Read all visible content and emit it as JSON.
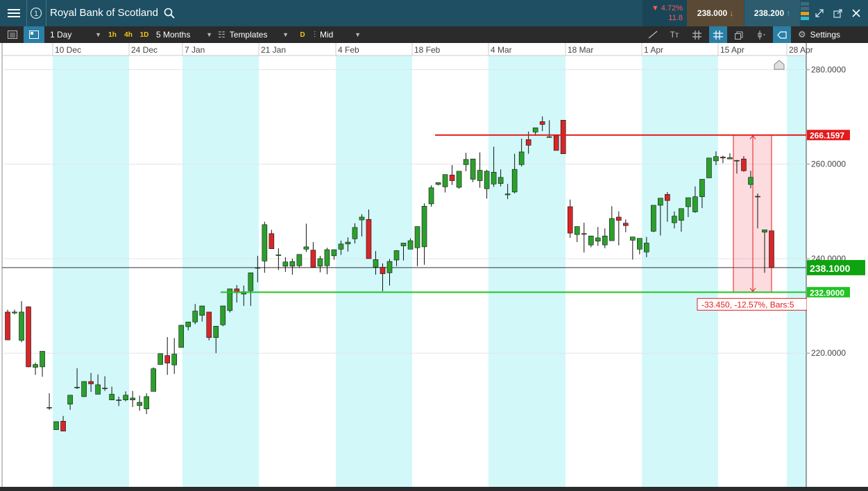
{
  "header": {
    "title": "Royal Bank of Scotland",
    "change_pct": "▼ 4.72%",
    "change_abs": "11.8",
    "sell_price": "238.000",
    "buy_price": "238.200"
  },
  "toolbar": {
    "interval": "1 Day",
    "quick_intervals": [
      "1h",
      "4h",
      "1D"
    ],
    "range": "5 Months",
    "templates": "Templates",
    "d_badge": "D",
    "price_mode": "Mid",
    "settings": "Settings"
  },
  "colors": {
    "header_bg": "#1e4f63",
    "toolbar_bg": "#2b2b2b",
    "up": "#2ca02c",
    "down": "#d62728",
    "weekend_band": "#d2f8fa",
    "resistance": "#e31a1c",
    "support": "#22c322",
    "current_price": "#0fa30f"
  },
  "chart_data": {
    "type": "candlestick",
    "x_tick_labels": [
      "10 Dec",
      "24 Dec",
      "7 Jan",
      "21 Jan",
      "4 Feb",
      "18 Feb",
      "4 Mar",
      "18 Mar",
      "1 Apr",
      "15 Apr",
      "28 Apr"
    ],
    "y_tick_labels": [
      "280.0000",
      "260.0000",
      "240.0000",
      "220.0000"
    ],
    "ylim": [
      191.7,
      283
    ],
    "candles": [
      [
        228.7,
        229.2,
        222.8,
        222.8
      ],
      [
        228.5,
        229.2,
        228.2,
        228.7
      ],
      [
        222.7,
        231.0,
        222.3,
        228.7
      ],
      [
        229.8,
        229.9,
        217.0,
        217.1
      ],
      [
        217.0,
        218.0,
        215.4,
        217.6
      ],
      [
        217.1,
        220.0,
        215.0,
        220.4
      ],
      [
        208.5,
        211.5,
        208.0,
        208.5
      ],
      [
        203.8,
        205.1,
        203.8,
        205.5
      ],
      [
        205.6,
        206.7,
        204.3,
        203.5
      ],
      [
        209.2,
        211.1,
        208.0,
        211.1
      ],
      [
        212.8,
        216.8,
        212.4,
        212.8
      ],
      [
        210.8,
        214.0,
        210.7,
        214.0
      ],
      [
        214.0,
        215.8,
        211.8,
        213.5
      ],
      [
        211.3,
        215.5,
        211.3,
        213.3
      ],
      [
        212.6,
        215.1,
        212.0,
        212.6
      ],
      [
        210.1,
        212.9,
        210.1,
        211.3
      ],
      [
        210.1,
        210.8,
        208.8,
        210.1
      ],
      [
        210.1,
        211.9,
        209.8,
        211.1
      ],
      [
        210.1,
        212.0,
        208.6,
        210.5
      ],
      [
        208.9,
        211.0,
        207.8,
        209.6
      ],
      [
        208.2,
        211.5,
        207.1,
        210.8
      ],
      [
        211.9,
        217.0,
        211.9,
        216.7
      ],
      [
        217.6,
        219.6,
        217.6,
        219.9
      ],
      [
        219.5,
        223.4,
        215.4,
        217.9
      ],
      [
        217.5,
        223.2,
        215.6,
        219.8
      ],
      [
        221.2,
        226.0,
        221.2,
        225.9
      ],
      [
        225.6,
        226.5,
        224.8,
        226.6
      ],
      [
        226.6,
        230.4,
        226.1,
        228.9
      ],
      [
        228.0,
        229.8,
        226.7,
        230.0
      ],
      [
        228.7,
        228.7,
        222.7,
        223.3
      ],
      [
        223.3,
        223.3,
        220.0,
        225.7
      ],
      [
        226.0,
        229.2,
        225.7,
        230.0
      ],
      [
        229.0,
        229.0,
        228.6,
        233.6
      ],
      [
        233.6,
        234.4,
        230.7,
        232.8
      ],
      [
        232.5,
        234.3,
        230.0,
        233.0
      ],
      [
        233.2,
        234.5,
        230.0,
        237.0
      ],
      [
        238.1,
        240.6,
        235.0,
        238.1
      ],
      [
        239.5,
        247.8,
        237.0,
        247.2
      ],
      [
        245.3,
        246.1,
        242.6,
        242.1
      ],
      [
        240.8,
        242.2,
        237.6,
        240.8
      ],
      [
        238.4,
        240.3,
        237.2,
        239.3
      ],
      [
        238.4,
        240.0,
        236.6,
        239.4
      ],
      [
        238.5,
        240.2,
        238.1,
        240.9
      ],
      [
        242.0,
        247.4,
        241.4,
        242.5
      ],
      [
        241.8,
        243.5,
        239.5,
        238.2
      ],
      [
        238.4,
        240.6,
        237.1,
        240.0
      ],
      [
        238.5,
        242.3,
        236.7,
        241.9
      ],
      [
        240.6,
        240.6,
        239.8,
        241.9
      ],
      [
        242.0,
        243.8,
        240.8,
        243.1
      ],
      [
        243.1,
        244.5,
        241.5,
        243.5
      ],
      [
        244.2,
        247.5,
        243.2,
        246.6
      ],
      [
        248.2,
        249.4,
        244.7,
        248.8
      ],
      [
        248.3,
        250.4,
        240.0,
        240.0
      ],
      [
        238.2,
        241.6,
        236.6,
        239.8
      ],
      [
        238.2,
        239.0,
        233.1,
        236.8
      ],
      [
        237.0,
        239.9,
        234.3,
        239.4
      ],
      [
        239.7,
        241.8,
        238.4,
        241.7
      ],
      [
        242.7,
        243.3,
        239.6,
        243.3
      ],
      [
        242.0,
        244.3,
        243.3,
        243.8
      ],
      [
        242.3,
        242.9,
        238.4,
        246.8
      ],
      [
        242.5,
        251.7,
        238.7,
        251.1
      ],
      [
        251.6,
        255.5,
        251.0,
        255.0
      ],
      [
        255.7,
        256.0,
        255.5,
        256.1
      ],
      [
        255.2,
        257.4,
        254.0,
        257.8
      ],
      [
        257.7,
        259.8,
        255.6,
        256.5
      ],
      [
        255.1,
        257.3,
        254.8,
        258.5
      ],
      [
        259.9,
        262.4,
        258.5,
        261.0
      ],
      [
        256.8,
        260.6,
        256.2,
        261.1
      ],
      [
        256.5,
        262.5,
        255.0,
        258.7
      ],
      [
        254.8,
        258.8,
        252.7,
        258.5
      ],
      [
        255.8,
        263.7,
        255.2,
        258.3
      ],
      [
        255.9,
        258.9,
        255.3,
        257.2
      ],
      [
        253.5,
        255.8,
        252.6,
        253.7
      ],
      [
        254.1,
        262.2,
        253.8,
        258.9
      ],
      [
        259.9,
        265.4,
        259.5,
        262.6
      ],
      [
        265.2,
        266.9,
        262.2,
        264.0
      ],
      [
        266.8,
        266.0,
        266.1,
        267.7
      ],
      [
        269.0,
        270.1,
        267.0,
        268.4
      ],
      [
        265.8,
        269.3,
        265.8,
        265.8
      ],
      [
        266.0,
        264.3,
        262.9,
        262.9
      ],
      [
        269.3,
        265.7,
        262.6,
        262.2
      ],
      [
        251.0,
        252.5,
        244.4,
        245.4
      ],
      [
        245.1,
        246.8,
        243.5,
        246.8
      ],
      [
        245.3,
        247.6,
        241.3,
        245.2
      ],
      [
        242.9,
        244.7,
        242.4,
        244.8
      ],
      [
        243.7,
        246.7,
        242.7,
        244.4
      ],
      [
        242.9,
        246.4,
        242.2,
        244.8
      ],
      [
        243.8,
        251.1,
        247.8,
        248.5
      ],
      [
        248.8,
        250.0,
        242.8,
        248.1
      ],
      [
        247.5,
        248.3,
        245.6,
        247.0
      ],
      [
        243.9,
        243.9,
        239.8,
        244.6
      ],
      [
        242.0,
        243.7,
        240.9,
        244.3
      ],
      [
        241.4,
        244.6,
        240.3,
        243.3
      ],
      [
        245.8,
        247.9,
        245.6,
        251.3
      ],
      [
        251.3,
        252.2,
        244.9,
        252.8
      ],
      [
        253.6,
        254.1,
        247.8,
        252.3
      ],
      [
        247.6,
        250.0,
        246.4,
        249.0
      ],
      [
        248.1,
        249.4,
        245.7,
        250.6
      ],
      [
        251.0,
        251.3,
        248.8,
        252.9
      ],
      [
        249.9,
        255.3,
        249.7,
        253.1
      ],
      [
        253.1,
        256.8,
        250.7,
        256.8
      ],
      [
        257.1,
        260.2,
        257.1,
        261.3
      ],
      [
        260.7,
        262.7,
        259.8,
        261.6
      ],
      [
        261.5,
        261.8,
        260.2,
        261.3
      ],
      [
        261.1,
        262.3,
        261.2,
        261.4
      ],
      [
        260.7,
        260.9,
        258.0,
        260.8
      ],
      [
        261.1,
        261.7,
        258.4,
        258.6
      ],
      [
        255.7,
        258.6,
        254.9,
        257.2
      ],
      [
        253.2,
        253.8,
        246.4,
        253.2
      ],
      [
        245.6,
        245.6,
        237.0,
        246.1
      ],
      [
        245.9,
        245.9,
        238.1,
        238.1
      ]
    ],
    "horizontal_lines": [
      {
        "price": 266.1597,
        "label": "266.1597"
      },
      {
        "price": 232.9,
        "label": "232.9000"
      },
      {
        "price": 238.1,
        "label": "238.1000"
      }
    ],
    "measure_label": "-33.450, -12.57%, Bars:5"
  }
}
